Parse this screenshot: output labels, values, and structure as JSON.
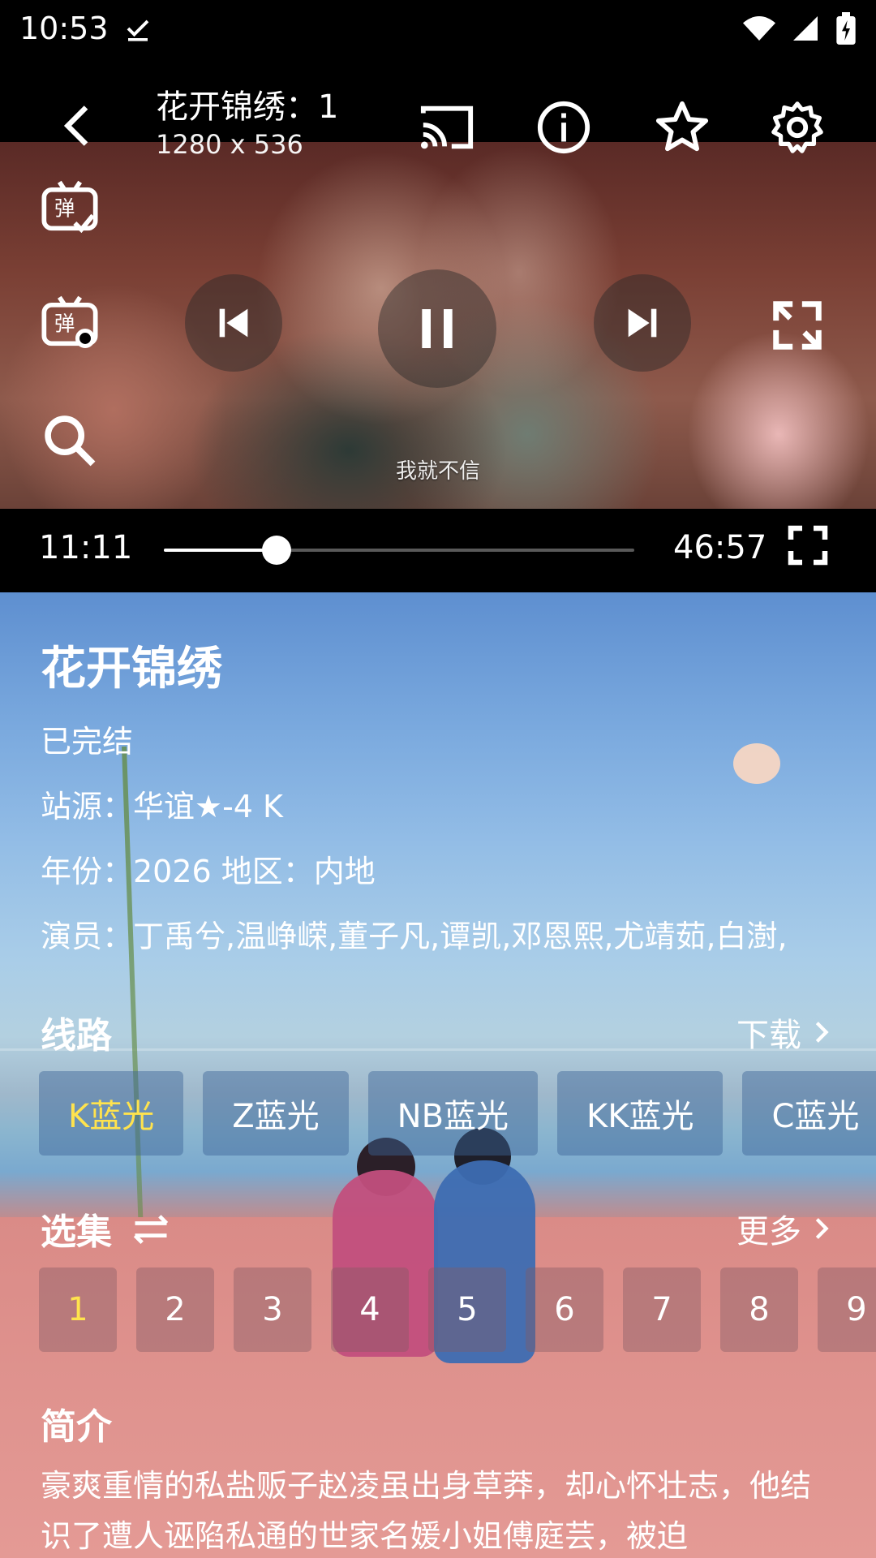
{
  "status_bar": {
    "time": "10:53"
  },
  "player": {
    "title": "花开锦绣：1",
    "resolution": "1280 x 536",
    "subtitle": "我就不信",
    "current_time": "11:11",
    "total_time": "46:57",
    "progress": 0.239
  },
  "show": {
    "title": "花开锦绣",
    "status": "已完结",
    "source": "站源：华谊★-4 K",
    "year_region": "年份：2026  地区：内地",
    "cast": "演员：丁禹兮,温峥嵘,董子凡,谭凯,邓恩熙,尤靖茹,白澍,"
  },
  "lines": {
    "title": "线路",
    "link": "下载",
    "items": [
      "K蓝光",
      "Z蓝光",
      "NB蓝光",
      "KK蓝光",
      "C蓝光"
    ]
  },
  "episodes": {
    "title": "选集",
    "link": "更多",
    "items": [
      "1",
      "2",
      "3",
      "4",
      "5",
      "6",
      "7",
      "8",
      "9"
    ]
  },
  "intro": {
    "title": "简介",
    "text": "豪爽重情的私盐贩子赵凌虽出身草莽，却心怀壮志，他结识了遭人诬陷私通的世家名媛小姐傅庭芸，被迫"
  }
}
